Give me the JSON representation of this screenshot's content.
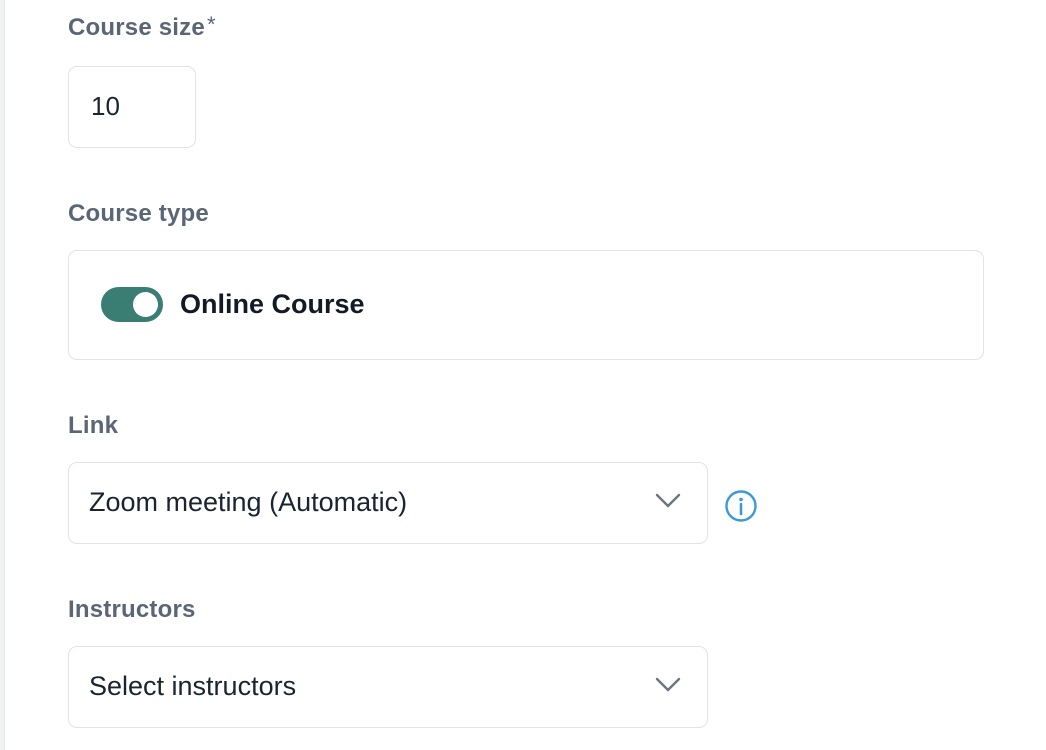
{
  "course_size": {
    "label": "Course size",
    "required_marker": "*",
    "value": "10"
  },
  "course_type": {
    "label": "Course type",
    "toggle_label": "Online Course",
    "toggle_on": true,
    "toggle_color": "#3a7d73"
  },
  "link": {
    "label": "Link",
    "selected": "Zoom meeting (Automatic)",
    "info_icon": "info-circle-icon",
    "info_color": "#3a9bd6"
  },
  "instructors": {
    "label": "Instructors",
    "placeholder": "Select instructors"
  }
}
